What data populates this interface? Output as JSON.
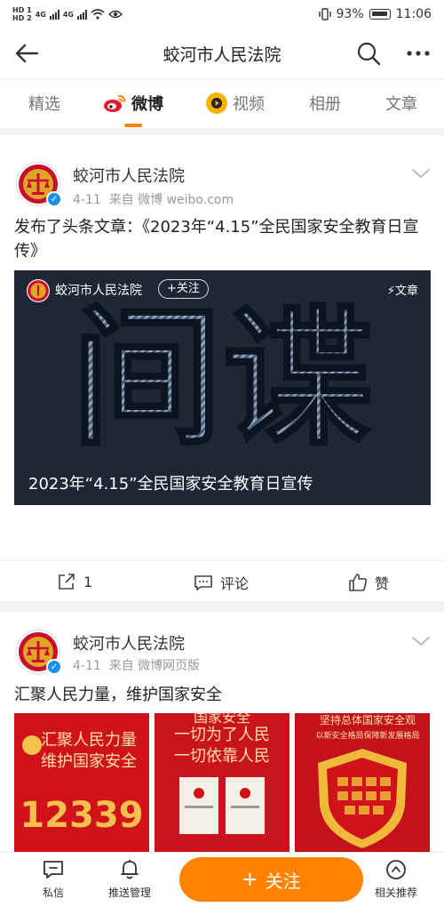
{
  "status_bar": {
    "left_tags": [
      "HD 1",
      "HD 2",
      "4G",
      "4G"
    ],
    "battery": "93%",
    "time": "11:06"
  },
  "header": {
    "title": "蛟河市人民法院"
  },
  "tabs": [
    {
      "label": "精选"
    },
    {
      "label": "微博",
      "active": true
    },
    {
      "label": "视频"
    },
    {
      "label": "相册"
    },
    {
      "label": "文章"
    }
  ],
  "accent": "#ff8200",
  "posts": [
    {
      "author": "蛟河市人民法院",
      "date": "4-11",
      "source": "来自 微博 weibo.com",
      "text": "发布了头条文章：《2023年“4.15”全民国家安全教育日宣传》",
      "media": {
        "author": "蛟河市人民法院",
        "follow_label": "+关注",
        "badge": "文章",
        "big_text": "间谍",
        "caption": "2023年“4.15”全民国家安全教育日宣传"
      },
      "actions": {
        "share": "1",
        "comment": "评论",
        "like": "赞"
      }
    },
    {
      "author": "蛟河市人民法院",
      "date": "4-11",
      "source": "来自 微博网页版",
      "text": "汇聚人民力量，维护国家安全",
      "thumbs": [
        {
          "lines": [
            "汇聚人民力量",
            "维护国家安全"
          ],
          "number": "12339"
        },
        {
          "lines": [
            "国家安全",
            "一切为了人民",
            "一切依靠人民"
          ]
        },
        {
          "lines": [
            "坚持总体国家安全观",
            "以新安全格局保障新发展格局"
          ]
        }
      ]
    }
  ],
  "bottom_bar": {
    "messages": "私信",
    "push": "推送管理",
    "follow": "关注",
    "related": "相关推荐"
  }
}
